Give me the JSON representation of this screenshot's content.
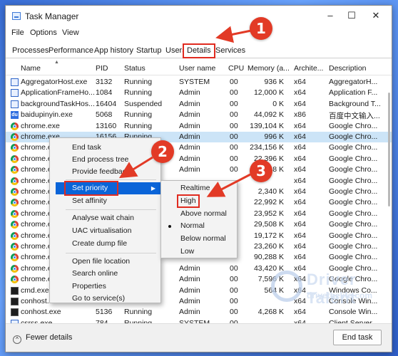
{
  "window": {
    "title": "Task Manager",
    "controls": [
      "–",
      "☐",
      "✕"
    ]
  },
  "menu": [
    "File",
    "Options",
    "View"
  ],
  "tabs": [
    "Processes",
    "Performance",
    "App history",
    "Startup",
    "Users",
    "Details",
    "Services"
  ],
  "active_tab": "Details",
  "columns": [
    "Name",
    "PID",
    "Status",
    "User name",
    "CPU",
    "Memory (a...",
    "Archite...",
    "Description"
  ],
  "rows": [
    {
      "icon": "exe-icon",
      "name": "AggregatorHost.exe",
      "pid": "3132",
      "status": "Running",
      "user": "SYSTEM",
      "cpu": "00",
      "mem": "936 K",
      "arch": "x64",
      "desc": "AggregatorH..."
    },
    {
      "icon": "exe-icon",
      "name": "ApplicationFrameHo...",
      "pid": "1084",
      "status": "Running",
      "user": "Admin",
      "cpu": "00",
      "mem": "12,000 K",
      "arch": "x64",
      "desc": "Application F..."
    },
    {
      "icon": "exe-icon",
      "name": "backgroundTaskHos...",
      "pid": "16404",
      "status": "Suspended",
      "user": "Admin",
      "cpu": "00",
      "mem": "0 K",
      "arch": "x64",
      "desc": "Background T..."
    },
    {
      "icon": "baidu-icon",
      "name": "baidupinyin.exe",
      "pid": "5068",
      "status": "Running",
      "user": "Admin",
      "cpu": "00",
      "mem": "44,092 K",
      "arch": "x86",
      "desc": "百度中文输入..."
    },
    {
      "icon": "chrome-icon",
      "name": "chrome.exe",
      "pid": "13160",
      "status": "Running",
      "user": "Admin",
      "cpu": "00",
      "mem": "139,104 K",
      "arch": "x64",
      "desc": "Google Chro..."
    },
    {
      "icon": "chrome-icon",
      "name": "chrome.exe",
      "pid": "16156",
      "status": "Running",
      "user": "Admin",
      "cpu": "00",
      "mem": "996 K",
      "arch": "x64",
      "desc": "Google Chro...",
      "selected": true
    },
    {
      "icon": "chrome-icon",
      "name": "chrome.e",
      "pid": "",
      "status": "",
      "user": "Admin",
      "cpu": "00",
      "mem": "234,156 K",
      "arch": "x64",
      "desc": "Google Chro..."
    },
    {
      "icon": "chrome-icon",
      "name": "chrome.e",
      "pid": "",
      "status": "",
      "user": "Admin",
      "cpu": "00",
      "mem": "22,396 K",
      "arch": "x64",
      "desc": "Google Chro..."
    },
    {
      "icon": "chrome-icon",
      "name": "chrome.e",
      "pid": "",
      "status": "",
      "user": "Admin",
      "cpu": "00",
      "mem": "48 K",
      "arch": "x64",
      "desc": "Google Chro..."
    },
    {
      "icon": "chrome-icon",
      "name": "chrome.e",
      "pid": "",
      "status": "",
      "user": "",
      "cpu": "",
      "mem": "",
      "arch": "x64",
      "desc": "Google Chro..."
    },
    {
      "icon": "chrome-icon",
      "name": "chrome.e",
      "pid": "",
      "status": "",
      "user": "",
      "cpu": "",
      "mem": "2,340 K",
      "arch": "x64",
      "desc": "Google Chro..."
    },
    {
      "icon": "chrome-icon",
      "name": "chrome.e",
      "pid": "",
      "status": "",
      "user": "",
      "cpu": "",
      "mem": "22,992 K",
      "arch": "x64",
      "desc": "Google Chro..."
    },
    {
      "icon": "chrome-icon",
      "name": "chrome.e",
      "pid": "",
      "status": "",
      "user": "",
      "cpu": "",
      "mem": "23,952 K",
      "arch": "x64",
      "desc": "Google Chro..."
    },
    {
      "icon": "chrome-icon",
      "name": "chrome.e",
      "pid": "",
      "status": "",
      "user": "",
      "cpu": "",
      "mem": "29,508 K",
      "arch": "x64",
      "desc": "Google Chro..."
    },
    {
      "icon": "chrome-icon",
      "name": "chrome.e",
      "pid": "",
      "status": "",
      "user": "",
      "cpu": "",
      "mem": "19,172 K",
      "arch": "x64",
      "desc": "Google Chro..."
    },
    {
      "icon": "chrome-icon",
      "name": "chrome.e",
      "pid": "",
      "status": "",
      "user": "",
      "cpu": "",
      "mem": "23,260 K",
      "arch": "x64",
      "desc": "Google Chro..."
    },
    {
      "icon": "chrome-icon",
      "name": "chrome.e",
      "pid": "",
      "status": "",
      "user": "",
      "cpu": "",
      "mem": "90,288 K",
      "arch": "x64",
      "desc": "Google Chro..."
    },
    {
      "icon": "chrome-icon",
      "name": "chrome.e",
      "pid": "",
      "status": "",
      "user": "Admin",
      "cpu": "00",
      "mem": "43,420 K",
      "arch": "x64",
      "desc": "Google Chro..."
    },
    {
      "icon": "chrome-icon",
      "name": "chrome.e",
      "pid": "",
      "status": "",
      "user": "Admin",
      "cpu": "00",
      "mem": "7,596 K",
      "arch": "x64",
      "desc": "Google Chro..."
    },
    {
      "icon": "cmd-icon",
      "name": "cmd.exe",
      "pid": "",
      "status": "",
      "user": "Admin",
      "cpu": "00",
      "mem": "564 K",
      "arch": "x64",
      "desc": "Windows Co..."
    },
    {
      "icon": "cmd-icon",
      "name": "conhost.exe",
      "pid": "",
      "status": "",
      "user": "Admin",
      "cpu": "00",
      "mem": "",
      "arch": "x64",
      "desc": "Console Win..."
    },
    {
      "icon": "cmd-icon",
      "name": "conhost.exe",
      "pid": "5136",
      "status": "Running",
      "user": "Admin",
      "cpu": "00",
      "mem": "4,268 K",
      "arch": "x64",
      "desc": "Console Win..."
    },
    {
      "icon": "exe-icon",
      "name": "csrss.exe",
      "pid": "784",
      "status": "Running",
      "user": "SYSTEM",
      "cpu": "00",
      "mem": "",
      "arch": "x64",
      "desc": "Client Server..."
    }
  ],
  "context_menu": {
    "items": [
      "End task",
      "End process tree",
      "Provide feedback",
      "Set priority",
      "Set affinity",
      "Analyse wait chain",
      "UAC virtualisation",
      "Create dump file",
      "Open file location",
      "Search online",
      "Properties",
      "Go to service(s)"
    ],
    "highlighted": "Set priority"
  },
  "priority_menu": {
    "items": [
      "Realtime",
      "High",
      "Above normal",
      "Normal",
      "Below normal",
      "Low"
    ],
    "selected": "Normal",
    "boxed": "High"
  },
  "callouts": [
    "1",
    "2",
    "3"
  ],
  "footer": {
    "fewer_details": "Fewer details",
    "fewer_icon": "^",
    "end_task": "End task"
  },
  "watermark": {
    "title": "Driver Talent",
    "url": "drivethelife.com"
  },
  "colors": {
    "accent": "#0a64d8",
    "callout": "#e23a26",
    "selected_row": "#cce4f7"
  }
}
